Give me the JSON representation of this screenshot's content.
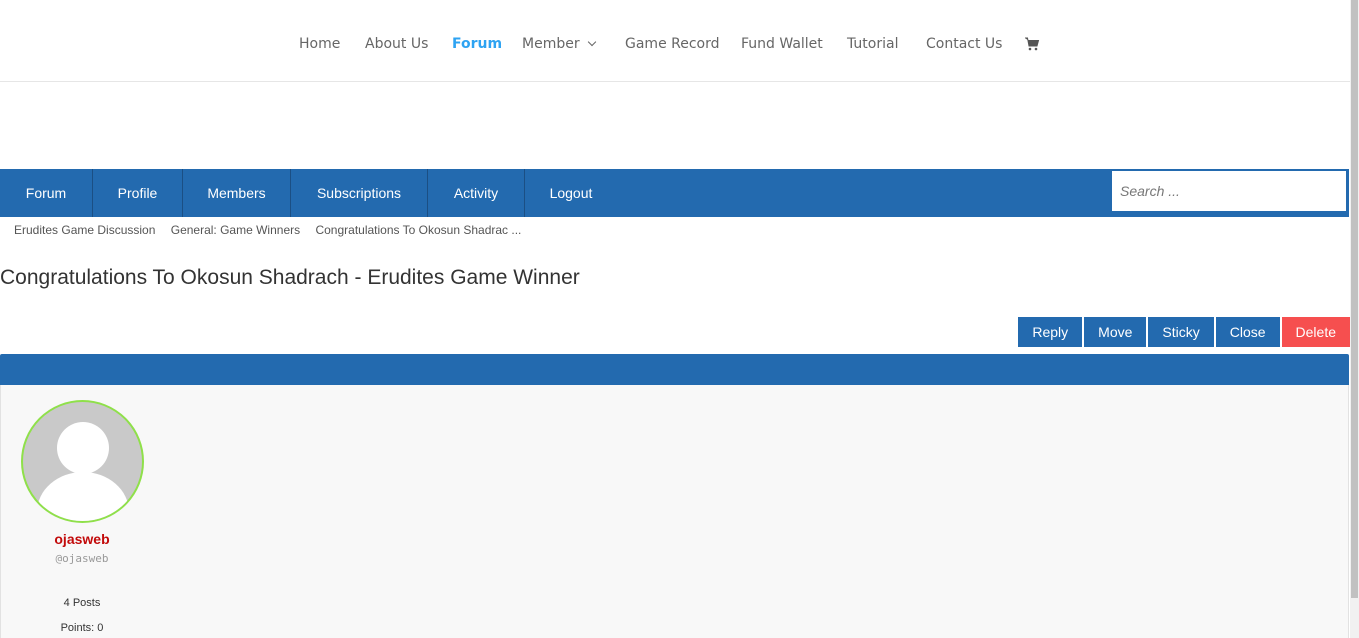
{
  "top_nav": {
    "items": [
      "Home",
      "About Us",
      "Forum",
      "Member",
      "Game Record",
      "Fund Wallet",
      "Tutorial",
      "Contact Us"
    ],
    "active": "Forum",
    "cart_icon": "cart-icon"
  },
  "forum_nav": {
    "items": [
      "Forum",
      "Profile",
      "Members",
      "Subscriptions",
      "Activity",
      "Logout"
    ],
    "search_placeholder": "Search ..."
  },
  "breadcrumb": [
    "Erudites Game Discussion",
    "General: Game Winners",
    "Congratulations To Okosun Shadrac ..."
  ],
  "topic": {
    "title": "Congratulations To Okosun Shadrach - Erudites Game Winner"
  },
  "actions": [
    "Reply",
    "Move",
    "Sticky",
    "Close",
    "Delete"
  ],
  "colors": {
    "accent": "#236aaf",
    "delete": "#f64f4f",
    "active_link": "#2ea3f2",
    "author_name": "#c20a0a",
    "avatar_border": "#8fe04a"
  },
  "post": {
    "author_name": "ojasweb",
    "author_handle": "@ojasweb",
    "posts": "4 Posts",
    "points": "Points: 0"
  }
}
